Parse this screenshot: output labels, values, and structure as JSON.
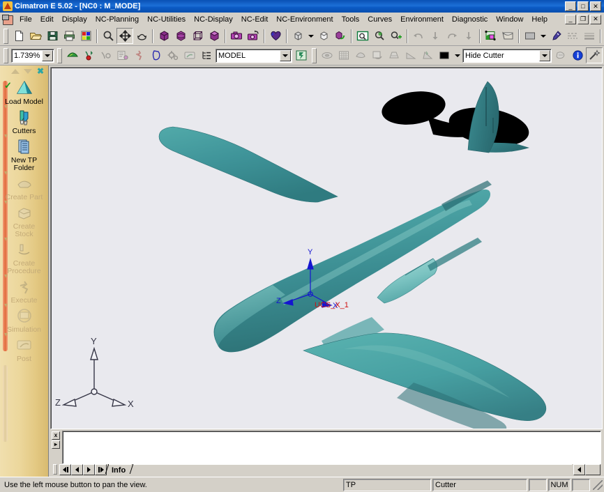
{
  "window": {
    "title": "Cimatron E 5.02 - [NC0 : M_MODE]",
    "app_icon": "cimatron-logo-icon",
    "controls": {
      "minimize": "_",
      "maximize": "□",
      "close": "✕",
      "mdi_minimize": "_",
      "mdi_restore": "❐",
      "mdi_close": "✕"
    }
  },
  "menubar": {
    "doc_icon": "document-control-icon",
    "items": [
      {
        "label": "File"
      },
      {
        "label": "Edit"
      },
      {
        "label": "Display"
      },
      {
        "label": "NC-Planning"
      },
      {
        "label": "NC-Utilities"
      },
      {
        "label": "NC-Display"
      },
      {
        "label": "NC-Edit"
      },
      {
        "label": "NC-Environment"
      },
      {
        "label": "Tools"
      },
      {
        "label": "Curves"
      },
      {
        "label": "Environment"
      },
      {
        "label": "Diagnostic"
      },
      {
        "label": "Window"
      },
      {
        "label": "Help"
      }
    ]
  },
  "toolbar_main": {
    "buttons": [
      {
        "name": "new-file-icon",
        "tip": "New"
      },
      {
        "name": "open-file-icon",
        "tip": "Open"
      },
      {
        "name": "save-file-icon",
        "tip": "Save"
      },
      {
        "name": "print-icon",
        "tip": "Print"
      },
      {
        "name": "palette-icon",
        "tip": "Colors"
      },
      {
        "name": "zoom-icon",
        "tip": "Zoom"
      },
      {
        "name": "pan-icon",
        "tip": "Pan"
      },
      {
        "name": "rotate-icon",
        "tip": "Rotate"
      },
      {
        "name": "iso-view-icon",
        "tip": "Isometric View"
      },
      {
        "name": "box-view-icon",
        "tip": "Box View"
      },
      {
        "name": "wireframe-view-icon",
        "tip": "Wireframe View"
      },
      {
        "name": "top-view-icon",
        "tip": "Top View"
      },
      {
        "name": "camera-icon",
        "tip": "Capture View"
      },
      {
        "name": "camera-restore-icon",
        "tip": "Restore View"
      },
      {
        "name": "shade-heart-icon",
        "tip": "Shading"
      },
      {
        "name": "cube-solid-icon",
        "tip": "Render Mode"
      },
      {
        "name": "cube-grey-icon",
        "tip": "Render Mode 2"
      },
      {
        "name": "refresh-cube-icon",
        "tip": "Regenerate"
      },
      {
        "name": "zoom-window-icon",
        "tip": "Zoom Window"
      },
      {
        "name": "zoom-select-icon",
        "tip": "Zoom Selection"
      },
      {
        "name": "zoom-all-icon",
        "tip": "Zoom All"
      },
      {
        "name": "undo-icon",
        "tip": "Undo"
      },
      {
        "name": "undo-step-icon",
        "tip": "Undo Step"
      },
      {
        "name": "redo-icon",
        "tip": "Redo"
      },
      {
        "name": "redo-step-icon",
        "tip": "Redo Step"
      },
      {
        "name": "layers-icon",
        "tip": "Layers"
      },
      {
        "name": "fill-icon",
        "tip": "Fill"
      },
      {
        "name": "color-swatch-icon",
        "tip": "Color"
      },
      {
        "name": "eyedropper-icon",
        "tip": "Pick Color"
      },
      {
        "name": "linetype-icon",
        "tip": "Line Type"
      },
      {
        "name": "linewidth-icon",
        "tip": "Line Width"
      },
      {
        "name": "light-bulb-icon",
        "tip": "Lighting"
      }
    ]
  },
  "toolbar_nc": {
    "zoom_value": "1.739%",
    "model_value": "MODEL",
    "cutter_value": "Hide Cutter",
    "buttons": [
      {
        "name": "load-model-green-icon"
      },
      {
        "name": "add-target-icon"
      },
      {
        "name": "measure-icon"
      },
      {
        "name": "report-icon"
      },
      {
        "name": "run-icon"
      },
      {
        "name": "toolpath-icon"
      },
      {
        "name": "gears-icon"
      },
      {
        "name": "post-icon"
      },
      {
        "name": "tree-list-icon"
      },
      {
        "name": "model-apply-icon"
      },
      {
        "name": "stock-disc-icon"
      },
      {
        "name": "grid-icon"
      },
      {
        "name": "part-icon"
      },
      {
        "name": "simulate-icon"
      },
      {
        "name": "machine-icon"
      },
      {
        "name": "ramp-icon"
      },
      {
        "name": "ramp2-icon"
      },
      {
        "name": "color-black-swatch-icon"
      },
      {
        "name": "cutter-edit-icon"
      },
      {
        "name": "info-icon"
      },
      {
        "name": "magic-wand-icon"
      }
    ]
  },
  "sidebar": {
    "header": {
      "up": "▲",
      "down": "▼",
      "close": "✖"
    },
    "items": [
      {
        "label": "Load Model",
        "icon": "load-model-icon",
        "enabled": true,
        "checked": true
      },
      {
        "label": "Cutters",
        "icon": "cutters-icon",
        "enabled": true,
        "checked": false
      },
      {
        "label": "New TP\nFolder",
        "icon": "new-tp-folder-icon",
        "enabled": true,
        "checked": false
      },
      {
        "label": "Create Part",
        "icon": "create-part-icon",
        "enabled": false,
        "checked": false
      },
      {
        "label": "Create\nStock",
        "icon": "create-stock-icon",
        "enabled": false,
        "checked": false
      },
      {
        "label": "Create\nProcedure",
        "icon": "create-procedure-icon",
        "enabled": false,
        "checked": false
      },
      {
        "label": "Execute",
        "icon": "execute-icon",
        "enabled": false,
        "checked": false
      },
      {
        "label": "Simulation",
        "icon": "simulation-icon",
        "enabled": false,
        "checked": false
      },
      {
        "label": "Post",
        "icon": "post-icon",
        "enabled": false,
        "checked": false
      }
    ]
  },
  "viewport": {
    "background_color": "#e9e9ee",
    "model": {
      "name": "aircraft-model",
      "description": "Shaded 3D fighter aircraft solid model",
      "body_color": "#3f9094",
      "highlight_color": "#7fc3c4",
      "shadow_color": "#2a6e72",
      "dark_surface_color": "#000000"
    },
    "ucs": {
      "label": "UCS_X_1",
      "axes": [
        "Y",
        "Z",
        "X"
      ],
      "color": "#1515d0",
      "label_color": "#d01010"
    },
    "axis_triad": {
      "name": "view-axis-triad",
      "axes": [
        "Y",
        "Z",
        "X"
      ],
      "color": "#303040"
    }
  },
  "message_area": {
    "text": "",
    "close_btn": "x",
    "expand_btn": "▸"
  },
  "tabs": {
    "active": "Info",
    "nav": {
      "first": "|◀",
      "prev": "◀",
      "next": "▶",
      "last": "▶|"
    }
  },
  "statusbar": {
    "message": "Use the left mouse button to pan the view.",
    "tp": "TP",
    "cutter": "Cutter",
    "blank1": "",
    "num": "NUM",
    "blank2": ""
  },
  "colors": {
    "titlebar_blue": "#0a51b5",
    "chrome_grey": "#d4d0c8",
    "sidebar_tan": "#ecd79c",
    "sidebar_track": "#e06a3c",
    "model_teal": "#3f9094"
  }
}
